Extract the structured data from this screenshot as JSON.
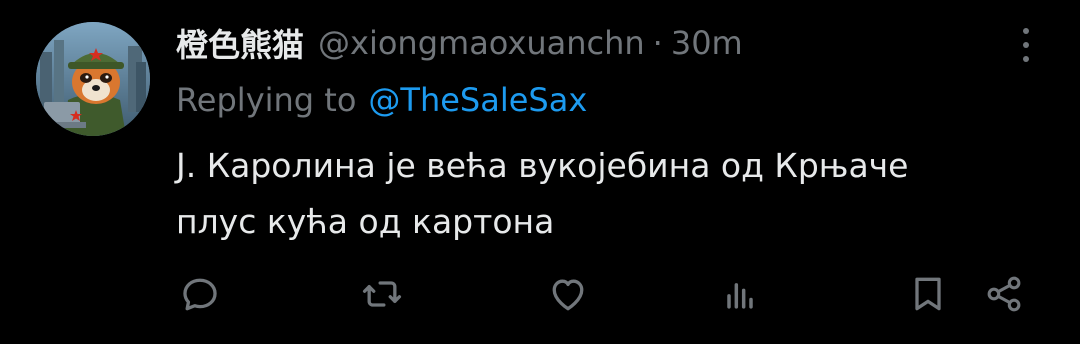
{
  "tweet": {
    "display_name": "橙色熊猫",
    "handle": "@xiongmaoxuanchn",
    "separator": "·",
    "time": "30m",
    "replying_prefix": "Replying to",
    "replying_to": "@TheSaleSax",
    "text_lines": [
      "J. Каролина је већа вукојебина од Крњаче",
      "плус кућа од картона"
    ]
  },
  "icons": {
    "more": "more-vertical-icon",
    "reply": "reply-icon",
    "retweet": "retweet-icon",
    "like": "like-icon",
    "views": "views-icon",
    "bookmark": "bookmark-icon",
    "share": "share-icon",
    "avatar": "panda-avatar"
  },
  "colors": {
    "background": "#000000",
    "primary_text": "#e7e9ea",
    "secondary_text": "#71767b",
    "link": "#1d9bf0"
  }
}
